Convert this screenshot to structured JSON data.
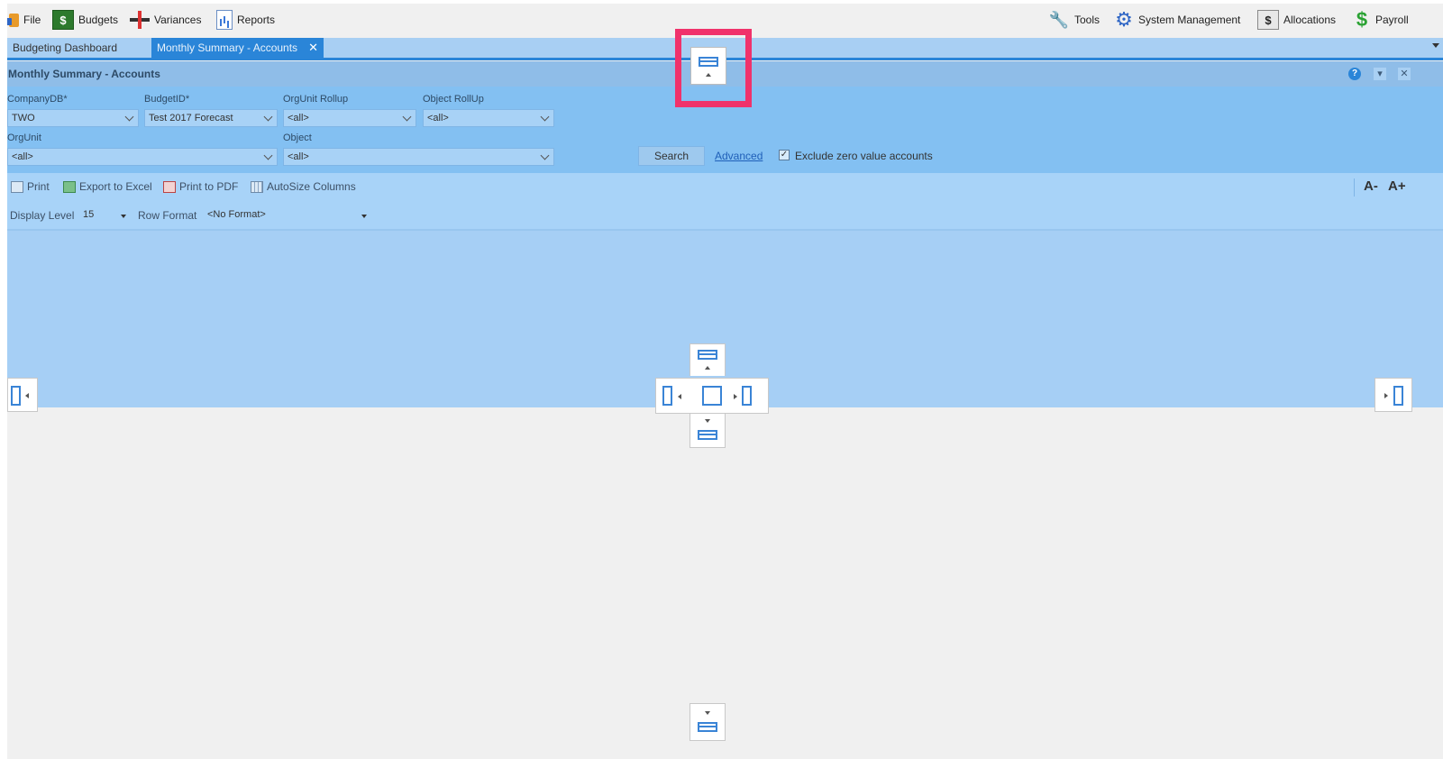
{
  "menu": {
    "file": "File",
    "budgets": "Budgets",
    "variances": "Variances",
    "reports": "Reports",
    "tools": "Tools",
    "system_management": "System Management",
    "allocations": "Allocations",
    "payroll": "Payroll"
  },
  "tabs": [
    {
      "label": "Budgeting Dashboard",
      "active": false
    },
    {
      "label": "Monthly Summary - Accounts",
      "active": true,
      "close_glyph": "✕"
    }
  ],
  "panel": {
    "title": "Monthly Summary - Accounts",
    "help_glyph": "?",
    "pin_glyph": "▾",
    "close_glyph": "✕"
  },
  "filters": {
    "company_label": "CompanyDB*",
    "company_value": "TWO",
    "budget_label": "BudgetID*",
    "budget_value": "Test 2017 Forecast",
    "orgunit_rollup_label": "OrgUnit Rollup",
    "orgunit_rollup_value": "<all>",
    "object_rollup_label": "Object RollUp",
    "object_rollup_value": "<all>",
    "orgunit_label": "OrgUnit",
    "orgunit_value": "<all>",
    "object_label": "Object",
    "object_value": "<all>",
    "search_label": "Search",
    "advanced_label": "Advanced",
    "exclude_zero_label": "Exclude zero value accounts",
    "exclude_zero_checked": true,
    "check_glyph": "✓"
  },
  "toolbar": {
    "print": "Print",
    "export_excel": "Export to Excel",
    "print_pdf": "Print to PDF",
    "autosize": "AutoSize Columns",
    "font_decrease": "A-",
    "font_increase": "A+"
  },
  "display": {
    "level_label": "Display Level",
    "level_value": "15",
    "row_format_label": "Row Format",
    "row_format_value": "<No Format>"
  },
  "colors": {
    "accent": "#2a85d8",
    "drop_preview": "#a6cff5",
    "highlight": "#f0326b"
  }
}
